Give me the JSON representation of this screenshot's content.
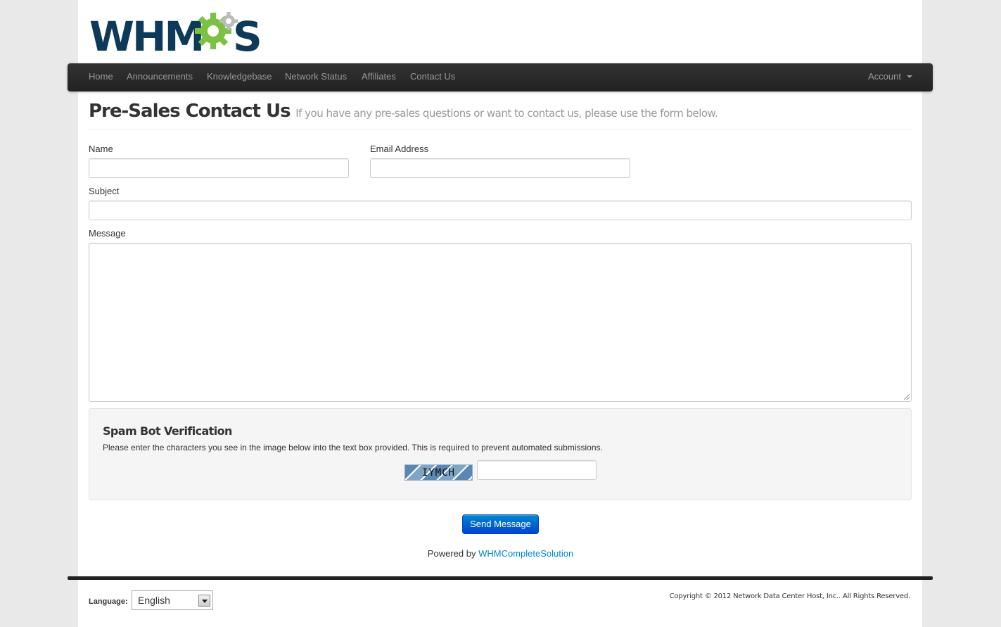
{
  "brand": {
    "logo_text": "WHMCS",
    "logo_color": "#0e3a5a",
    "gear_color": "#7cc242"
  },
  "nav": {
    "items": [
      {
        "label": "Home"
      },
      {
        "label": "Announcements"
      },
      {
        "label": "Knowledgebase"
      },
      {
        "label": "Network Status"
      },
      {
        "label": "Affiliates"
      },
      {
        "label": "Contact Us"
      }
    ],
    "account_label": "Account"
  },
  "header": {
    "title": "Pre-Sales Contact Us",
    "subtitle": "If you have any pre-sales questions or want to contact us, please use the form below."
  },
  "form": {
    "name_label": "Name",
    "name_value": "",
    "email_label": "Email Address",
    "email_value": "",
    "subject_label": "Subject",
    "subject_value": "",
    "message_label": "Message",
    "message_value": ""
  },
  "spam": {
    "title": "Spam Bot Verification",
    "instructions": "Please enter the characters you see in the image below into the text box provided. This is required to prevent automated submissions.",
    "captcha_text": "IYMCH",
    "code_value": ""
  },
  "actions": {
    "send_label": "Send Message"
  },
  "powered": {
    "prefix": "Powered by",
    "link_text": "WHMCompleteSolution"
  },
  "footer": {
    "language_label": "Language:",
    "language_value": "English",
    "copyright": "Copyright © 2012 Network Data Center Host, Inc.. All Rights Reserved."
  }
}
